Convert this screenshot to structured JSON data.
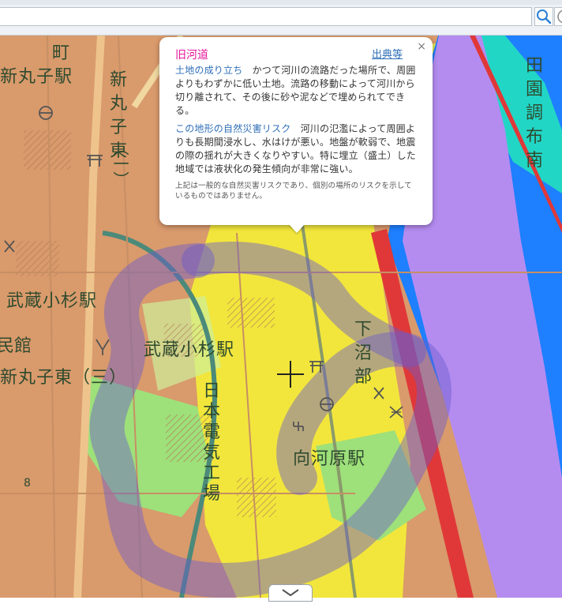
{
  "search": {
    "value": "",
    "placeholder": ""
  },
  "icons": {
    "search": "search-icon",
    "help": "help-icon",
    "close": "close-icon",
    "crosshair": "crosshair-icon",
    "expand": "chevron-down-icon"
  },
  "popup": {
    "title": "旧河道",
    "source_link": "出典等",
    "close": "×",
    "origin_label": "土地の成り立ち",
    "origin_text": "かつて河川の流路だった場所で、周囲よりもわずかに低い土地。流路の移動によって河川から切り離されて、その後に砂や泥などで埋められてできる。",
    "risk_label": "この地形の自然災害リスク",
    "risk_text": "河川の氾濫によって周囲よりも長期間浸水し、水はけが悪い。地盤が軟弱で、地震の際の揺れが大きくなりやすい。特に埋立（盛土）した地域では液状化の発生傾向が非常に強い。",
    "note": "上記は一般的な自然災害リスクであり、個別の場所のリスクを示しているものではありません。"
  },
  "map_labels": {
    "machi": "町",
    "shinmaruko_station": "新丸子駅",
    "shinmaruko_higashi_1": "新丸子東",
    "chome_1": "（一）",
    "denen_chofu_minami": "田園調布南",
    "musashikosugi_station_left": "武蔵小杉駅",
    "minkan": "民館",
    "shinmaruko_higashi_3": "新丸子東（三）",
    "musashikosugi_station": "武蔵小杉駅",
    "nihon_denki_kojo": "日本電気工場",
    "shimonumabe": "下沼部",
    "mukaigawara_station": "向河原駅",
    "number_8": "8"
  },
  "colors": {
    "old_channel": "#6a5acd",
    "river": "#b48cf0",
    "high_risk_blue": "#1e90ff",
    "terrace": "#d99a6c",
    "lowland": "#f5f542",
    "link": "#2f6fb7",
    "title": "#e6199b"
  }
}
